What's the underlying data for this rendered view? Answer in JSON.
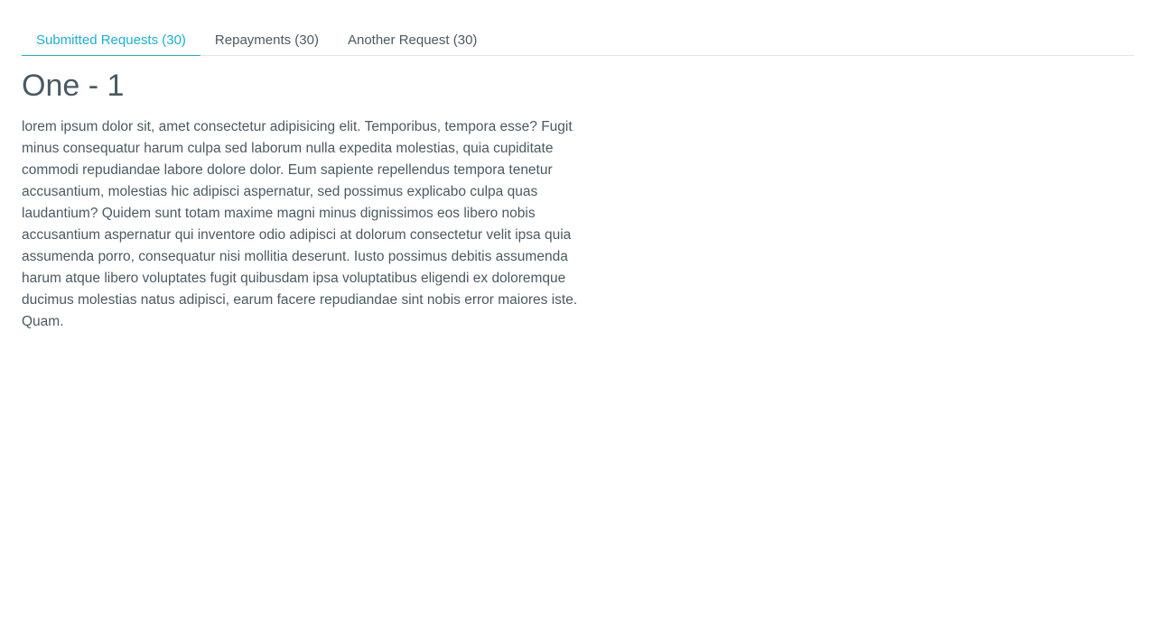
{
  "tabs": [
    {
      "label": "Submitted Requests (30)",
      "active": true
    },
    {
      "label": "Repayments (30)",
      "active": false
    },
    {
      "label": "Another Request (30)",
      "active": false
    }
  ],
  "content": {
    "title": "One - 1",
    "body": "lorem ipsum dolor sit, amet consectetur adipisicing elit. Temporibus, tempora esse? Fugit minus consequatur harum culpa sed laborum nulla expedita molestias, quia cupiditate commodi repudiandae labore dolore dolor. Eum sapiente repellendus tempora tenetur accusantium, molestias hic adipisci aspernatur, sed possimus explicabo culpa quas laudantium? Quidem sunt totam maxime magni minus dignissimos eos libero nobis accusantium aspernatur qui inventore odio adipisci at dolorum consectetur velit ipsa quia assumenda porro, consequatur nisi mollitia deserunt. Iusto possimus debitis assumenda harum atque libero voluptates fugit quibusdam ipsa voluptatibus eligendi ex doloremque ducimus molestias natus adipisci, earum facere repudiandae sint nobis error maiores iste. Quam."
  },
  "colors": {
    "accent": "#1ab0d8",
    "text": "#4a5a63",
    "divider": "#e3e6e8",
    "background": "#ffffff"
  }
}
